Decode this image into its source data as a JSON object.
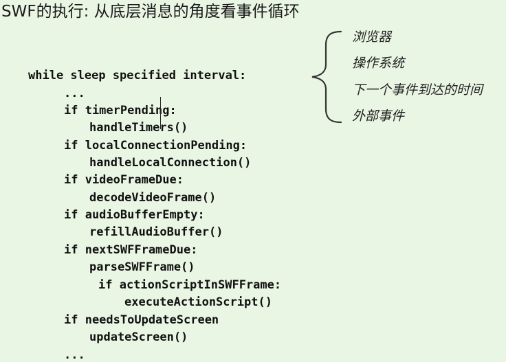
{
  "slide": {
    "title": "SWF的执行: 从底层消息的角度看事件循环"
  },
  "code": {
    "lines": [
      "while sleep specified interval:",
      "...",
      "if timerPending:",
      "handleTimers()",
      "if localConnectionPending:",
      "handleLocalConnection()",
      "if videoFrameDue:",
      "decodeVideoFrame()",
      "if audioBufferEmpty:",
      "refillAudioBuffer()",
      "if nextSWFFrameDue:",
      "parseSWFFrame()",
      "if actionScriptInSWFFrame:",
      "executeActionScript()",
      "if needsToUpdateScreen",
      "updateScreen()",
      "..."
    ]
  },
  "annotations": {
    "items": [
      "浏览器",
      "操作系统",
      "下一个事件到达的时间",
      "外部事件"
    ]
  }
}
